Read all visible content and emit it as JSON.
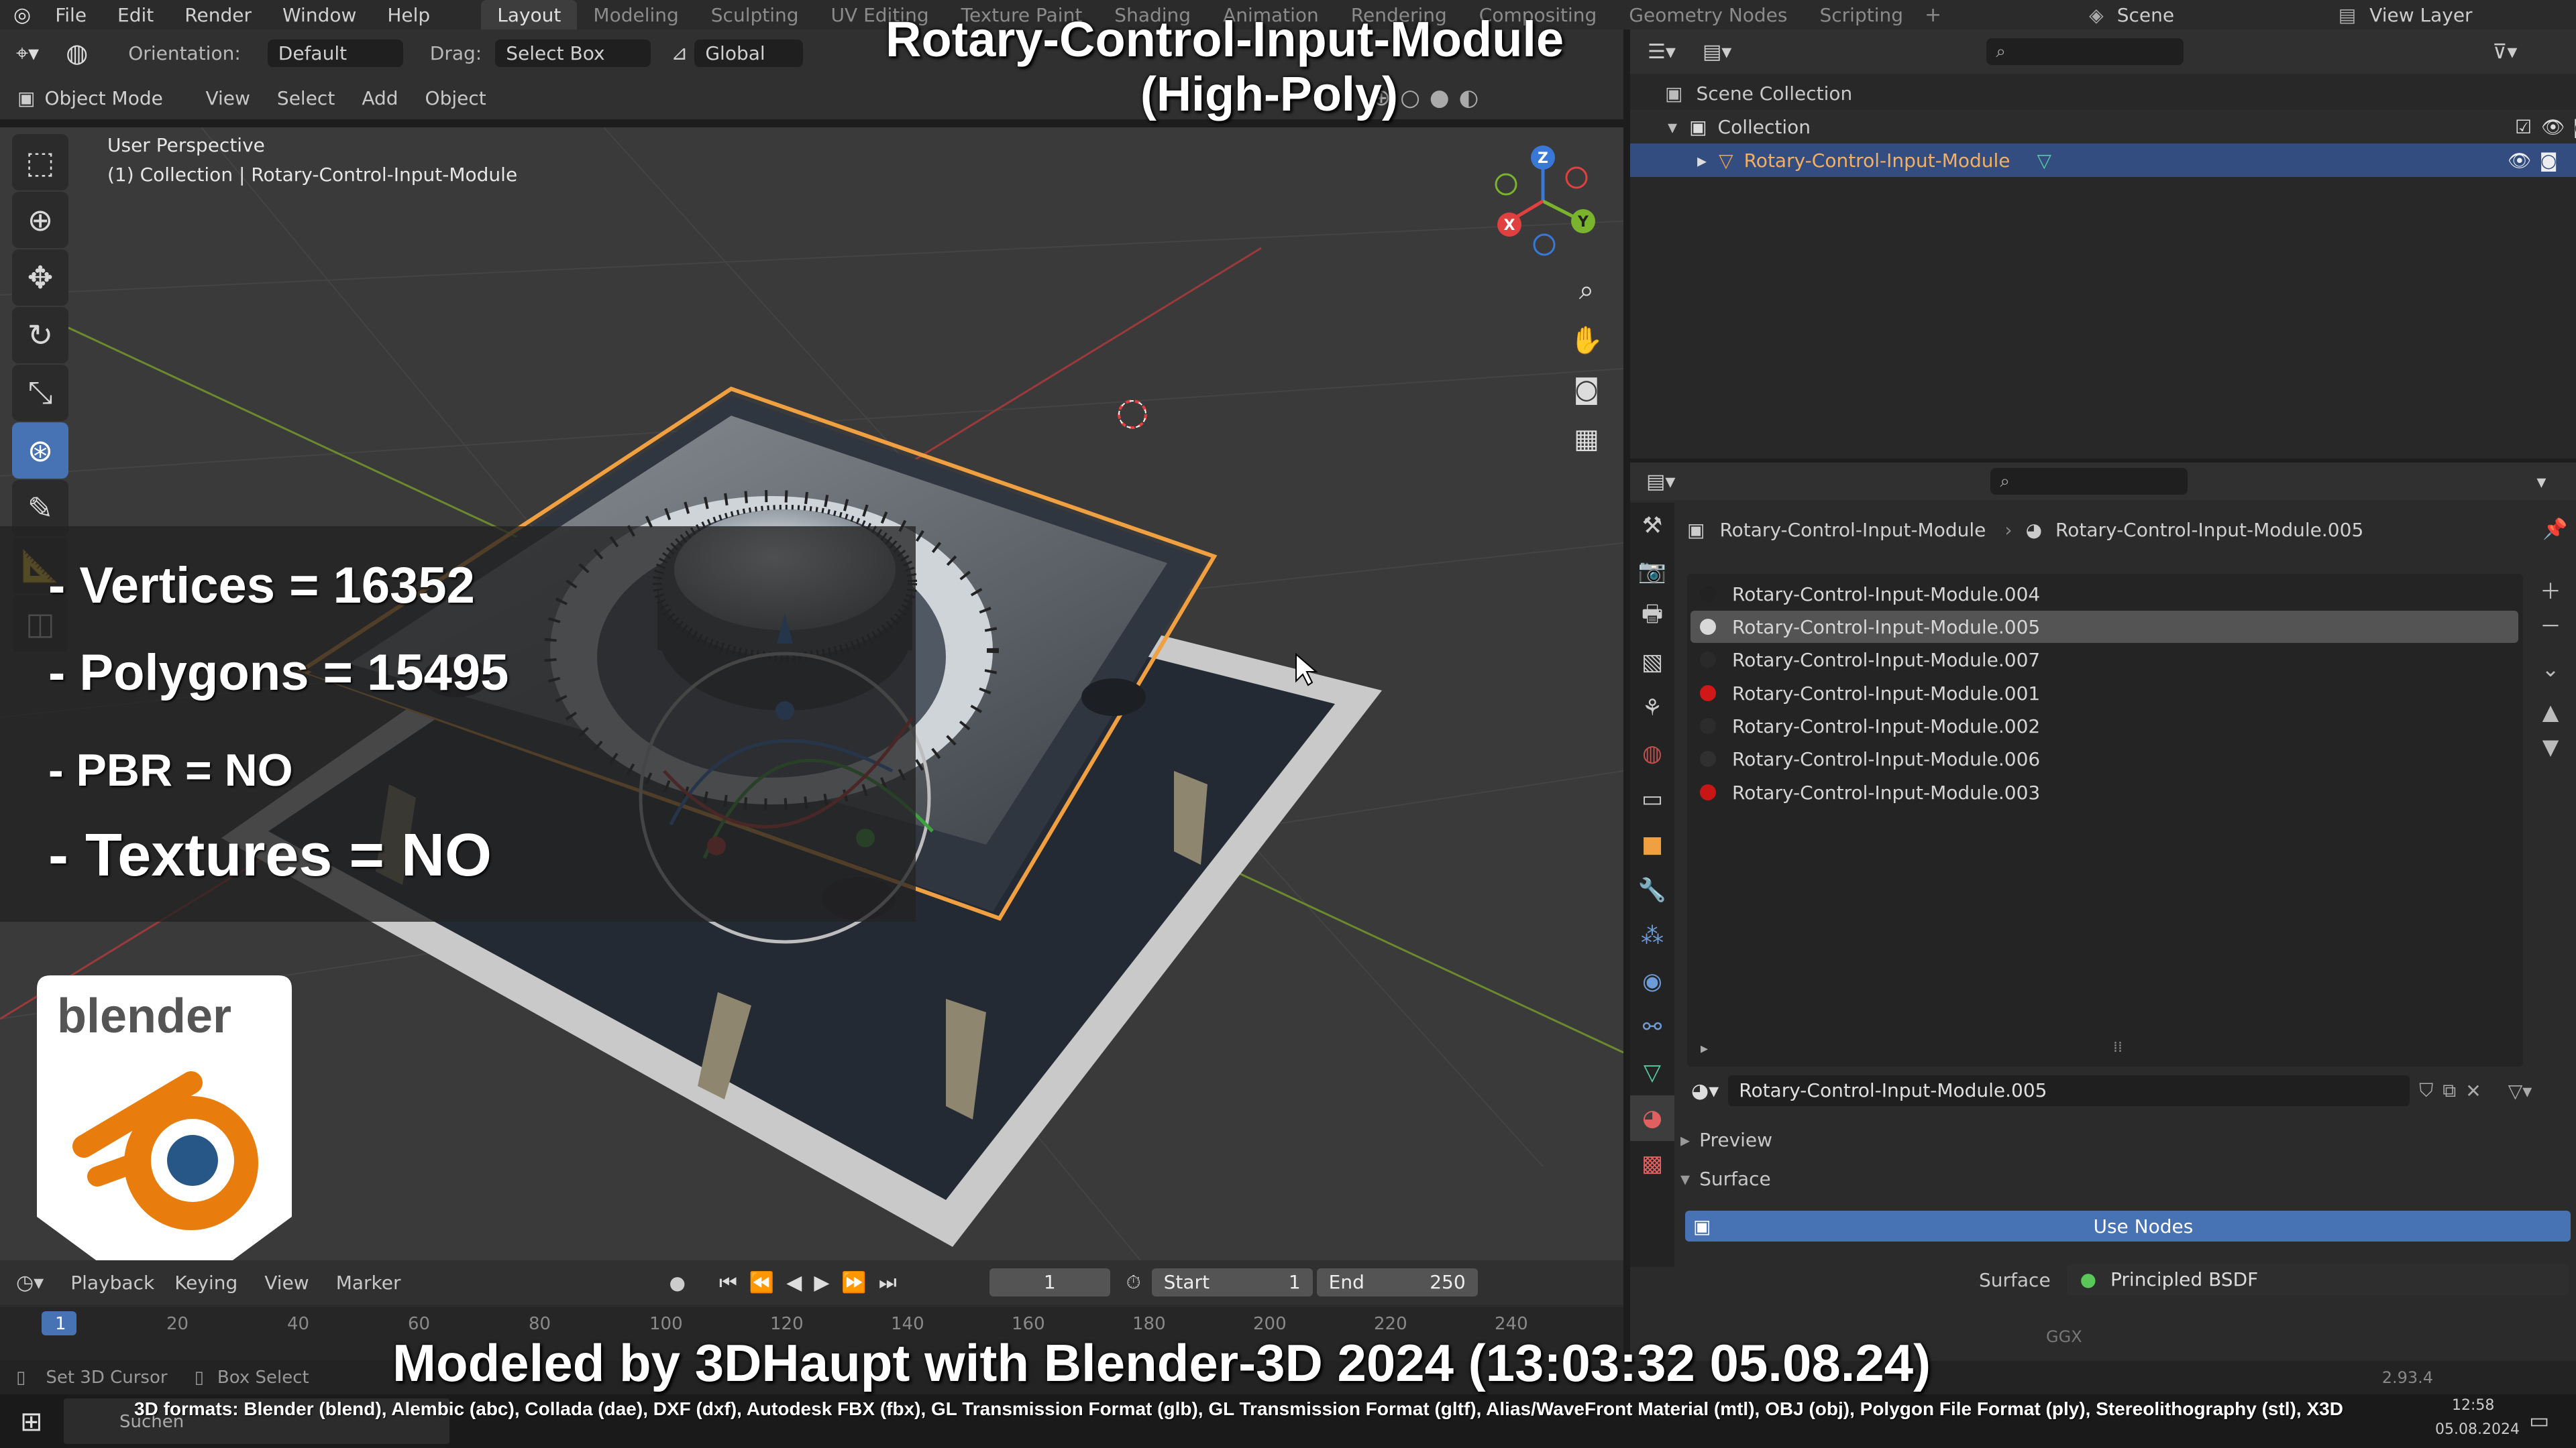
{
  "menu": {
    "items": [
      "File",
      "Edit",
      "Render",
      "Window",
      "Help"
    ],
    "workspaces": [
      "Layout",
      "Modeling",
      "Sculpting",
      "UV Editing",
      "Texture Paint",
      "Shading",
      "Animation",
      "Rendering",
      "Compositing",
      "Geometry Nodes",
      "Scripting"
    ],
    "active_workspace": "Layout",
    "scene": "Scene",
    "view_layer": "View Layer"
  },
  "header": {
    "orientation_label": "Orientation:",
    "orientation_value": "Default",
    "drag_label": "Drag:",
    "drag_value": "Select Box",
    "transform_value": "Global",
    "mode": "Object Mode",
    "menus": [
      "View",
      "Select",
      "Add",
      "Object"
    ]
  },
  "viewport": {
    "perspective": "User Perspective",
    "collection_info": "(1) Collection | Rotary-Control-Input-Module",
    "axes": [
      "X",
      "Y",
      "Z"
    ]
  },
  "overlay": {
    "title_line1": "Rotary-Control-Input-Module",
    "title_line2": "(High-Poly)",
    "stats": [
      "- Vertices = 16352",
      "- Polygons = 15495",
      "- PBR =  NO",
      "- Textures = NO"
    ],
    "logo_text": "blender",
    "footer": "Modeled by 3DHaupt with Blender-3D 2024 (13:03:32  05.08.24)",
    "formats": "3D formats: Blender (blend), Alembic (abc), Collada (dae), DXF (dxf), Autodesk FBX (fbx), GL Transmission Format (glb), GL Transmission Format (gltf), Alias/WaveFront Material (mtl), OBJ (obj), Polygon File Format (ply), Stereolithography (stl), X3D"
  },
  "outliner": {
    "root": "Scene Collection",
    "collection": "Collection",
    "object": "Rotary-Control-Input-Module"
  },
  "properties": {
    "breadcrumb_object": "Rotary-Control-Input-Module",
    "breadcrumb_material": "Rotary-Control-Input-Module.005",
    "materials": [
      {
        "name": "Rotary-Control-Input-Module.004",
        "color": "#222222"
      },
      {
        "name": "Rotary-Control-Input-Module.005",
        "color": "#d8d8d8"
      },
      {
        "name": "Rotary-Control-Input-Module.007",
        "color": "#2a2a2a"
      },
      {
        "name": "Rotary-Control-Input-Module.001",
        "color": "#d01818"
      },
      {
        "name": "Rotary-Control-Input-Module.002",
        "color": "#2c2c2c"
      },
      {
        "name": "Rotary-Control-Input-Module.006",
        "color": "#303030"
      },
      {
        "name": "Rotary-Control-Input-Module.003",
        "color": "#c81616"
      }
    ],
    "selected_index": 1,
    "material_field": "Rotary-Control-Input-Module.005",
    "preview_label": "Preview",
    "surface_label": "Surface",
    "use_nodes": "Use Nodes",
    "surface_field_label": "Surface",
    "surface_value": "Principled BSDF",
    "ggx": "GGX"
  },
  "timeline": {
    "menus": [
      "Playback",
      "Keying",
      "View",
      "Marker"
    ],
    "current_frame": "1",
    "start_label": "Start",
    "start_value": "1",
    "end_label": "End",
    "end_value": "250",
    "ticks": [
      "1",
      "20",
      "40",
      "60",
      "80",
      "100",
      "120",
      "140",
      "160",
      "180",
      "200",
      "220",
      "240"
    ]
  },
  "status": {
    "left": "Set 3D Cursor",
    "mid": "Box Select",
    "version": "2.93.4"
  },
  "taskbar": {
    "search": "Suchen",
    "time": "12:58",
    "date": "05.08.2024"
  },
  "colors": {
    "accent": "#4772b3",
    "selection_outline": "#f0a040",
    "logo_orange": "#e87d0d",
    "logo_blue": "#265787"
  }
}
